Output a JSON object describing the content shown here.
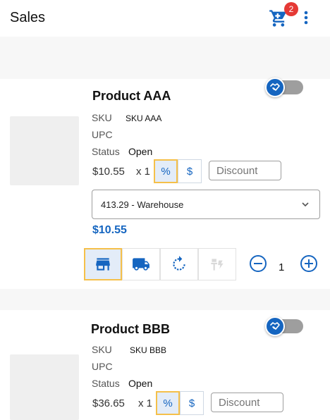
{
  "header": {
    "title": "Sales",
    "cart_count": "2",
    "accent": "#1565c0",
    "badge_color": "#e53935"
  },
  "products": [
    {
      "name": "Product AAA",
      "sku_label": "SKU",
      "sku": "SKU AAA",
      "upc_label": "UPC",
      "upc": "",
      "status_label": "Status",
      "status": "Open",
      "price": "$10.55",
      "qty_text": "x 1",
      "percent_label": "%",
      "dollar_label": "$",
      "discount_placeholder": "Discount",
      "location": "413.29 - Warehouse",
      "total": "$10.55",
      "quantity": "1"
    },
    {
      "name": "Product BBB",
      "sku_label": "SKU",
      "sku": "SKU BBB",
      "upc_label": "UPC",
      "upc": "",
      "status_label": "Status",
      "status": "Open",
      "price": "$36.65",
      "qty_text": "x 1",
      "percent_label": "%",
      "dollar_label": "$",
      "discount_placeholder": "Discount"
    }
  ],
  "icons": {
    "cart": "cart-icon",
    "menu": "more-vert-icon",
    "toggle": "handshake-icon",
    "store": "store-icon",
    "truck": "truck-icon",
    "refresh": "refresh-icon",
    "special": "special-order-icon",
    "minus": "minus-circle-icon",
    "plus": "plus-circle-icon",
    "chevron": "chevron-down-icon"
  }
}
